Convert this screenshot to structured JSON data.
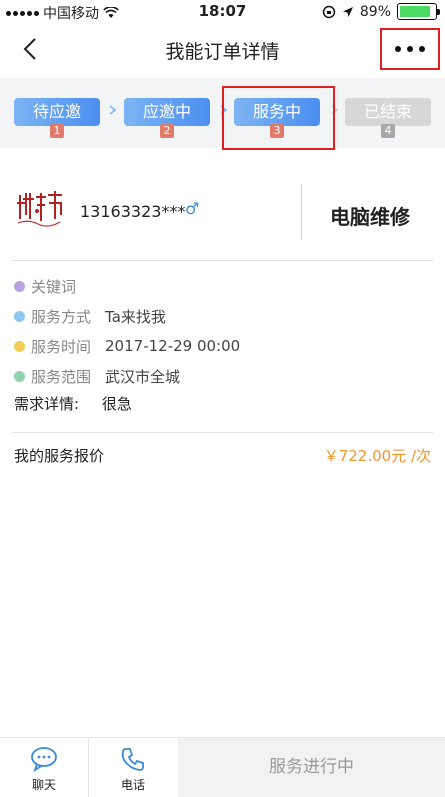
{
  "status_bar": {
    "carrier": "中国移动",
    "time": "18:07",
    "battery": "89%"
  },
  "nav": {
    "title": "我能订单详情"
  },
  "steps": [
    {
      "label": "待应邀",
      "num": "1",
      "state": "done"
    },
    {
      "label": "应邀中",
      "num": "2",
      "state": "done"
    },
    {
      "label": "服务中",
      "num": "3",
      "state": "current"
    },
    {
      "label": "已结束",
      "num": "4",
      "state": "pending"
    }
  ],
  "user": {
    "phone": "13163323***",
    "gender": "♂",
    "service_name": "电脑维修"
  },
  "info": {
    "keyword_label": "关键词",
    "service_method_label": "服务方式",
    "service_method_value": "Ta来找我",
    "service_time_label": "服务时间",
    "service_time_value": "2017-12-29 00:00",
    "service_area_label": "服务范围",
    "service_area_value": "武汉市全城",
    "detail_label": "需求详情:",
    "detail_value": "很急"
  },
  "quote": {
    "label": "我的服务报价",
    "value": "￥722.00元 /次"
  },
  "bottom": {
    "chat_label": "聊天",
    "phone_label": "电话",
    "status_label": "服务进行中"
  },
  "colors": {
    "accent": "#4a8ef0",
    "price": "#f0962a",
    "highlight_border": "#e02020"
  }
}
